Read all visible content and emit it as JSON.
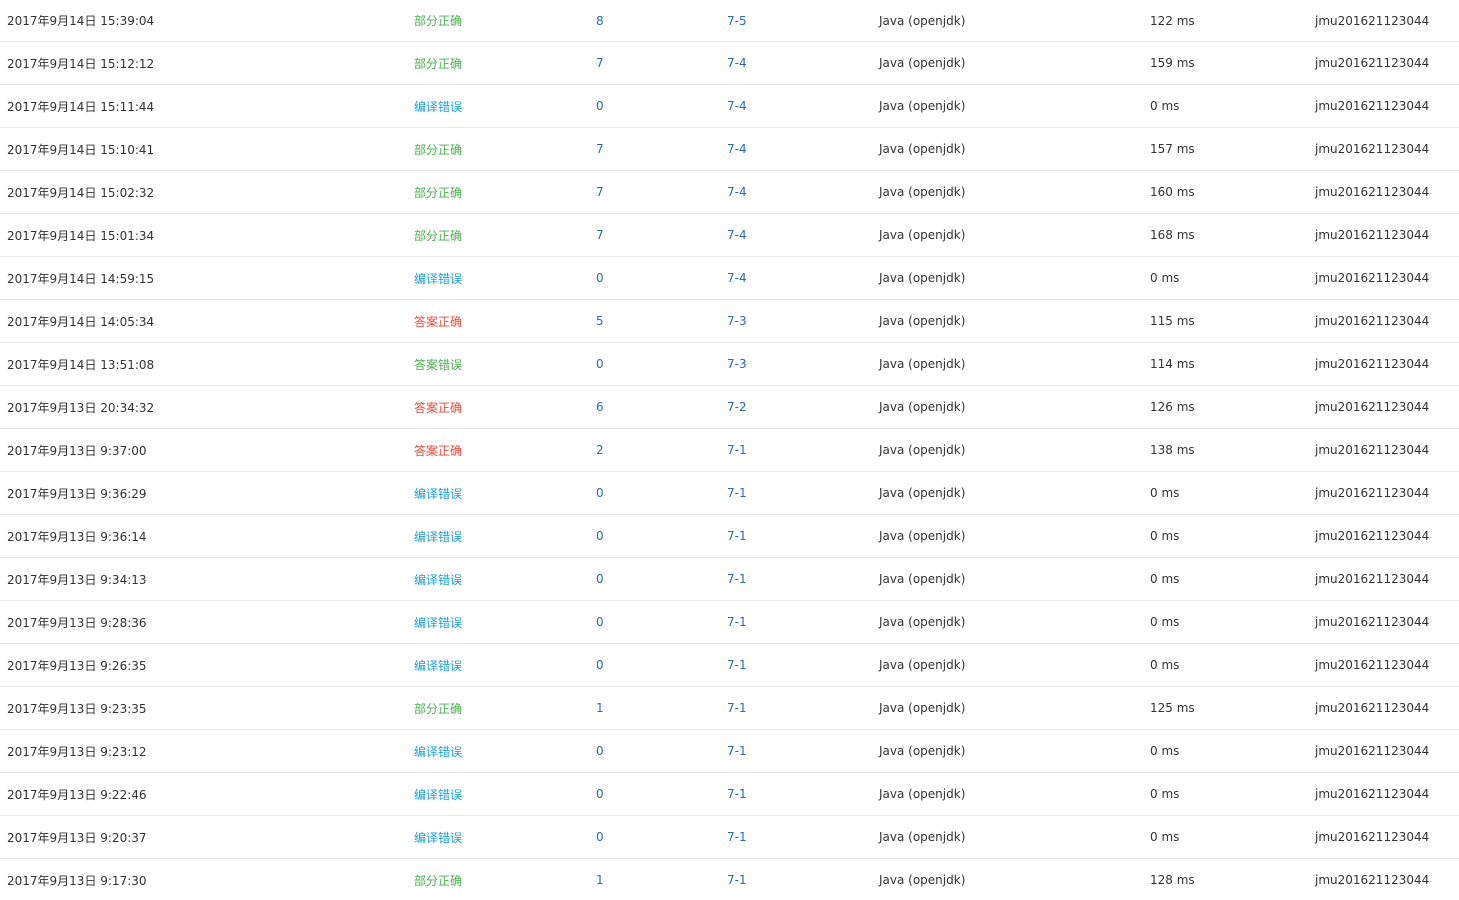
{
  "status_colors": {
    "部分正确": "#4caf50",
    "编译错误": "#1e9fd8",
    "答案正确": "#e74c3c",
    "答案错误": "#4caf50"
  },
  "submissions": [
    {
      "time": "2017年9月14日 15:39:04",
      "status": "部分正确",
      "score": "8",
      "problem": "7-5",
      "language": "Java (openjdk)",
      "elapsed": "122 ms",
      "user": "jmu201621123044"
    },
    {
      "time": "2017年9月14日 15:12:12",
      "status": "部分正确",
      "score": "7",
      "problem": "7-4",
      "language": "Java (openjdk)",
      "elapsed": "159 ms",
      "user": "jmu201621123044"
    },
    {
      "time": "2017年9月14日 15:11:44",
      "status": "编译错误",
      "score": "0",
      "problem": "7-4",
      "language": "Java (openjdk)",
      "elapsed": "0 ms",
      "user": "jmu201621123044"
    },
    {
      "time": "2017年9月14日 15:10:41",
      "status": "部分正确",
      "score": "7",
      "problem": "7-4",
      "language": "Java (openjdk)",
      "elapsed": "157 ms",
      "user": "jmu201621123044"
    },
    {
      "time": "2017年9月14日 15:02:32",
      "status": "部分正确",
      "score": "7",
      "problem": "7-4",
      "language": "Java (openjdk)",
      "elapsed": "160 ms",
      "user": "jmu201621123044"
    },
    {
      "time": "2017年9月14日 15:01:34",
      "status": "部分正确",
      "score": "7",
      "problem": "7-4",
      "language": "Java (openjdk)",
      "elapsed": "168 ms",
      "user": "jmu201621123044"
    },
    {
      "time": "2017年9月14日 14:59:15",
      "status": "编译错误",
      "score": "0",
      "problem": "7-4",
      "language": "Java (openjdk)",
      "elapsed": "0 ms",
      "user": "jmu201621123044"
    },
    {
      "time": "2017年9月14日 14:05:34",
      "status": "答案正确",
      "score": "5",
      "problem": "7-3",
      "language": "Java (openjdk)",
      "elapsed": "115 ms",
      "user": "jmu201621123044"
    },
    {
      "time": "2017年9月14日 13:51:08",
      "status": "答案错误",
      "score": "0",
      "problem": "7-3",
      "language": "Java (openjdk)",
      "elapsed": "114 ms",
      "user": "jmu201621123044"
    },
    {
      "time": "2017年9月13日 20:34:32",
      "status": "答案正确",
      "score": "6",
      "problem": "7-2",
      "language": "Java (openjdk)",
      "elapsed": "126 ms",
      "user": "jmu201621123044"
    },
    {
      "time": "2017年9月13日 9:37:00",
      "status": "答案正确",
      "score": "2",
      "problem": "7-1",
      "language": "Java (openjdk)",
      "elapsed": "138 ms",
      "user": "jmu201621123044"
    },
    {
      "time": "2017年9月13日 9:36:29",
      "status": "编译错误",
      "score": "0",
      "problem": "7-1",
      "language": "Java (openjdk)",
      "elapsed": "0 ms",
      "user": "jmu201621123044"
    },
    {
      "time": "2017年9月13日 9:36:14",
      "status": "编译错误",
      "score": "0",
      "problem": "7-1",
      "language": "Java (openjdk)",
      "elapsed": "0 ms",
      "user": "jmu201621123044"
    },
    {
      "time": "2017年9月13日 9:34:13",
      "status": "编译错误",
      "score": "0",
      "problem": "7-1",
      "language": "Java (openjdk)",
      "elapsed": "0 ms",
      "user": "jmu201621123044"
    },
    {
      "time": "2017年9月13日 9:28:36",
      "status": "编译错误",
      "score": "0",
      "problem": "7-1",
      "language": "Java (openjdk)",
      "elapsed": "0 ms",
      "user": "jmu201621123044"
    },
    {
      "time": "2017年9月13日 9:26:35",
      "status": "编译错误",
      "score": "0",
      "problem": "7-1",
      "language": "Java (openjdk)",
      "elapsed": "0 ms",
      "user": "jmu201621123044"
    },
    {
      "time": "2017年9月13日 9:23:35",
      "status": "部分正确",
      "score": "1",
      "problem": "7-1",
      "language": "Java (openjdk)",
      "elapsed": "125 ms",
      "user": "jmu201621123044"
    },
    {
      "time": "2017年9月13日 9:23:12",
      "status": "编译错误",
      "score": "0",
      "problem": "7-1",
      "language": "Java (openjdk)",
      "elapsed": "0 ms",
      "user": "jmu201621123044"
    },
    {
      "time": "2017年9月13日 9:22:46",
      "status": "编译错误",
      "score": "0",
      "problem": "7-1",
      "language": "Java (openjdk)",
      "elapsed": "0 ms",
      "user": "jmu201621123044"
    },
    {
      "time": "2017年9月13日 9:20:37",
      "status": "编译错误",
      "score": "0",
      "problem": "7-1",
      "language": "Java (openjdk)",
      "elapsed": "0 ms",
      "user": "jmu201621123044"
    },
    {
      "time": "2017年9月13日 9:17:30",
      "status": "部分正确",
      "score": "1",
      "problem": "7-1",
      "language": "Java (openjdk)",
      "elapsed": "128 ms",
      "user": "jmu201621123044"
    }
  ]
}
